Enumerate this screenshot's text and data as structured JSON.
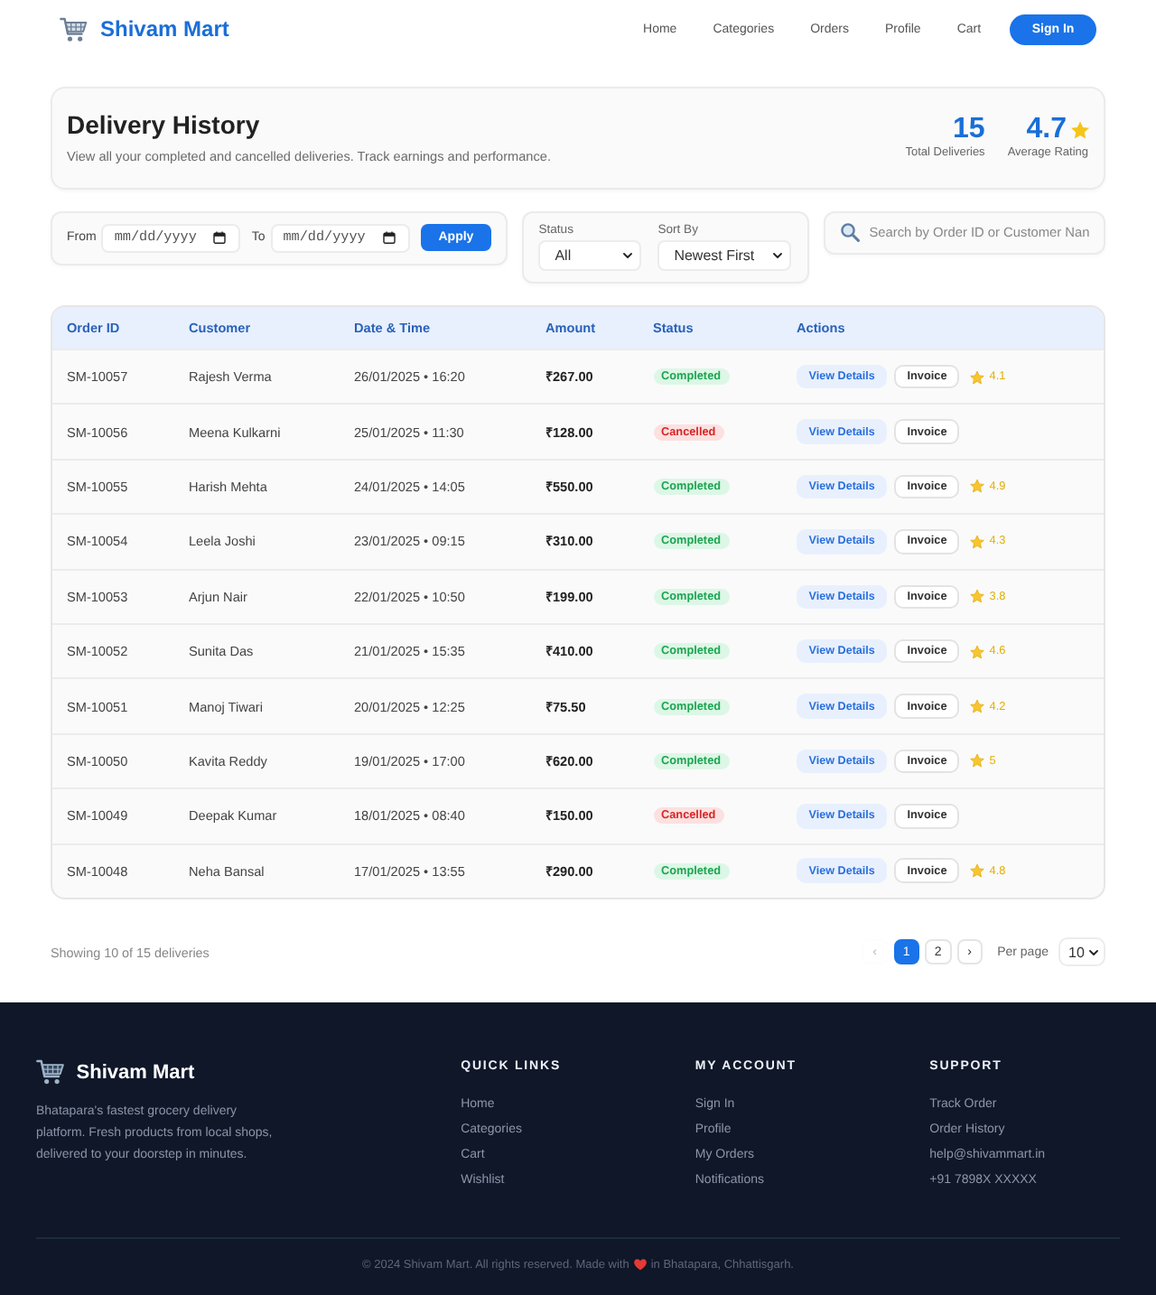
{
  "header": {
    "brand": "Shivam Mart",
    "nav": [
      "Home",
      "Categories",
      "Orders",
      "Profile",
      "Cart"
    ],
    "sign_in": "Sign In"
  },
  "summary": {
    "title": "Delivery History",
    "subtitle": "View all your completed and cancelled deliveries. Track earnings and performance.",
    "stats": [
      {
        "kind": "count",
        "value": "15",
        "label": "Total Deliveries"
      },
      {
        "kind": "rating",
        "value": "4.7",
        "label": "Average Rating"
      }
    ]
  },
  "date_filter": {
    "from_label": "From",
    "from": {
      "placeholder": "mm/dd/yyyy"
    },
    "to_label": "To",
    "to": {
      "placeholder": "mm/dd/yyyy"
    },
    "apply": "Apply"
  },
  "select_filters": [
    {
      "label": "Status",
      "value": "All"
    },
    {
      "label": "Sort By",
      "value": "Newest First"
    }
  ],
  "search": {
    "placeholder": "Search by Order ID or Customer Nan"
  },
  "table": {
    "columns": [
      "Order ID",
      "Customer",
      "Date & Time",
      "Amount",
      "Status",
      "Actions"
    ],
    "rows": [
      {
        "order_id": "SM-10057",
        "customer": "Rajesh Verma",
        "datetime": "26/01/2025 • 16:20",
        "amount": "₹267.00",
        "status": {
          "label": "Completed",
          "kind": "completed"
        },
        "view": "View Details",
        "invoice": "Invoice",
        "rating": "4.1"
      },
      {
        "order_id": "SM-10056",
        "customer": "Meena Kulkarni",
        "datetime": "25/01/2025 • 11:30",
        "amount": "₹128.00",
        "status": {
          "label": "Cancelled",
          "kind": "cancelled"
        },
        "view": "View Details",
        "invoice": "Invoice"
      },
      {
        "order_id": "SM-10055",
        "customer": "Harish Mehta",
        "datetime": "24/01/2025 • 14:05",
        "amount": "₹550.00",
        "status": {
          "label": "Completed",
          "kind": "completed"
        },
        "view": "View Details",
        "invoice": "Invoice",
        "rating": "4.9"
      },
      {
        "order_id": "SM-10054",
        "customer": "Leela Joshi",
        "datetime": "23/01/2025 • 09:15",
        "amount": "₹310.00",
        "status": {
          "label": "Completed",
          "kind": "completed"
        },
        "view": "View Details",
        "invoice": "Invoice",
        "rating": "4.3"
      },
      {
        "order_id": "SM-10053",
        "customer": "Arjun Nair",
        "datetime": "22/01/2025 • 10:50",
        "amount": "₹199.00",
        "status": {
          "label": "Completed",
          "kind": "completed"
        },
        "view": "View Details",
        "invoice": "Invoice",
        "rating": "3.8"
      },
      {
        "order_id": "SM-10052",
        "customer": "Sunita Das",
        "datetime": "21/01/2025 • 15:35",
        "amount": "₹410.00",
        "status": {
          "label": "Completed",
          "kind": "completed"
        },
        "view": "View Details",
        "invoice": "Invoice",
        "rating": "4.6"
      },
      {
        "order_id": "SM-10051",
        "customer": "Manoj Tiwari",
        "datetime": "20/01/2025 • 12:25",
        "amount": "₹75.50",
        "status": {
          "label": "Completed",
          "kind": "completed"
        },
        "view": "View Details",
        "invoice": "Invoice",
        "rating": "4.2"
      },
      {
        "order_id": "SM-10050",
        "customer": "Kavita Reddy",
        "datetime": "19/01/2025 • 17:00",
        "amount": "₹620.00",
        "status": {
          "label": "Completed",
          "kind": "completed"
        },
        "view": "View Details",
        "invoice": "Invoice",
        "rating": "5"
      },
      {
        "order_id": "SM-10049",
        "customer": "Deepak Kumar",
        "datetime": "18/01/2025 • 08:40",
        "amount": "₹150.00",
        "status": {
          "label": "Cancelled",
          "kind": "cancelled"
        },
        "view": "View Details",
        "invoice": "Invoice"
      },
      {
        "order_id": "SM-10048",
        "customer": "Neha Bansal",
        "datetime": "17/01/2025 • 13:55",
        "amount": "₹290.00",
        "status": {
          "label": "Completed",
          "kind": "completed"
        },
        "view": "View Details",
        "invoice": "Invoice",
        "rating": "4.8"
      }
    ]
  },
  "pagination": {
    "summary": "Showing 10 of 15 deliveries",
    "prev": {
      "label": "‹",
      "disabled": true
    },
    "pages": [
      {
        "label": "1",
        "selected": true
      },
      {
        "label": "2",
        "selected": false
      }
    ],
    "next": {
      "label": "›",
      "disabled": false
    },
    "per_page_label": "Per page",
    "per_page": "10"
  },
  "footer": {
    "brand": "Shivam Mart",
    "description": "Bhatapara's fastest grocery delivery platform. Fresh products from local shops, delivered to your doorstep in minutes.",
    "columns": [
      {
        "title": "QUICK LINKS",
        "links": [
          "Home",
          "Categories",
          "Cart",
          "Wishlist"
        ]
      },
      {
        "title": "MY ACCOUNT",
        "links": [
          "Sign In",
          "Profile",
          "My Orders",
          "Notifications"
        ]
      },
      {
        "title": "SUPPORT",
        "links": [
          "Track Order",
          "Order History",
          "help@shivammart.in",
          "+91 7898X XXXXX"
        ]
      }
    ],
    "copyright": "© 2024 Shivam Mart. All rights reserved. Made with",
    "location": "in Bhatapara, Chhattisgarh."
  }
}
